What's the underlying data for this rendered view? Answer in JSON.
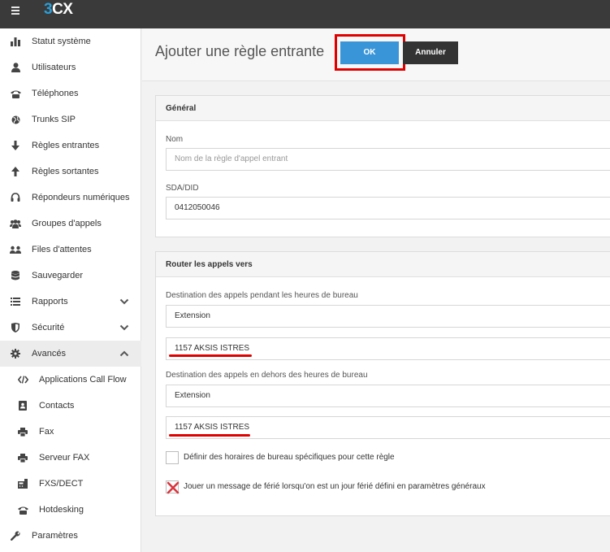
{
  "app": {
    "logo_prefix": "3",
    "logo_suffix": "CX"
  },
  "sidebar": {
    "items": [
      {
        "label": "Statut système",
        "icon": "bar-chart-icon"
      },
      {
        "label": "Utilisateurs",
        "icon": "user-icon"
      },
      {
        "label": "Téléphones",
        "icon": "phone-icon"
      },
      {
        "label": "Trunks SIP",
        "icon": "globe-icon"
      },
      {
        "label": "Règles entrantes",
        "icon": "arrow-down-icon"
      },
      {
        "label": "Règles sortantes",
        "icon": "arrow-up-icon"
      },
      {
        "label": "Répondeurs numériques",
        "icon": "headset-icon"
      },
      {
        "label": "Groupes d'appels",
        "icon": "users-icon"
      },
      {
        "label": "Files d'attentes",
        "icon": "group-icon"
      },
      {
        "label": "Sauvegarder",
        "icon": "database-icon"
      },
      {
        "label": "Rapports",
        "icon": "list-icon"
      },
      {
        "label": "Sécurité",
        "icon": "shield-icon"
      },
      {
        "label": "Avancés",
        "icon": "gear-icon"
      },
      {
        "label": "Applications Call Flow",
        "icon": "code-icon"
      },
      {
        "label": "Contacts",
        "icon": "contact-card-icon"
      },
      {
        "label": "Fax",
        "icon": "fax-icon"
      },
      {
        "label": "Serveur FAX",
        "icon": "fax-server-icon"
      },
      {
        "label": "FXS/DECT",
        "icon": "fxs-icon"
      },
      {
        "label": "Hotdesking",
        "icon": "desk-phone-icon"
      },
      {
        "label": "Paramètres",
        "icon": "wrench-icon"
      }
    ]
  },
  "header": {
    "title": "Ajouter une règle entrante",
    "ok_label": "OK",
    "cancel_label": "Annuler"
  },
  "general": {
    "title": "Général",
    "name_label": "Nom",
    "name_placeholder": "Nom de la règle d'appel entrant",
    "did_label": "SDA/DID",
    "did_value": "0412050046"
  },
  "routing": {
    "title": "Router les appels vers",
    "office_hours_label": "Destination des appels pendant les heures de bureau",
    "office_hours_type": "Extension",
    "office_hours_target": "1157 AKSIS ISTRES",
    "after_hours_label": "Destination des appels en dehors des heures de bureau",
    "after_hours_type": "Extension",
    "after_hours_target": "1157 AKSIS ISTRES",
    "custom_hours_label": "Définir des horaires de bureau spécifiques pour cette règle",
    "holiday_label": "Jouer un message de férié lorsqu'on est un jour férié défini en paramètres généraux"
  },
  "colors": {
    "accent": "#3a95d8",
    "highlight": "#e00000",
    "topbar": "#3a3a3a"
  }
}
